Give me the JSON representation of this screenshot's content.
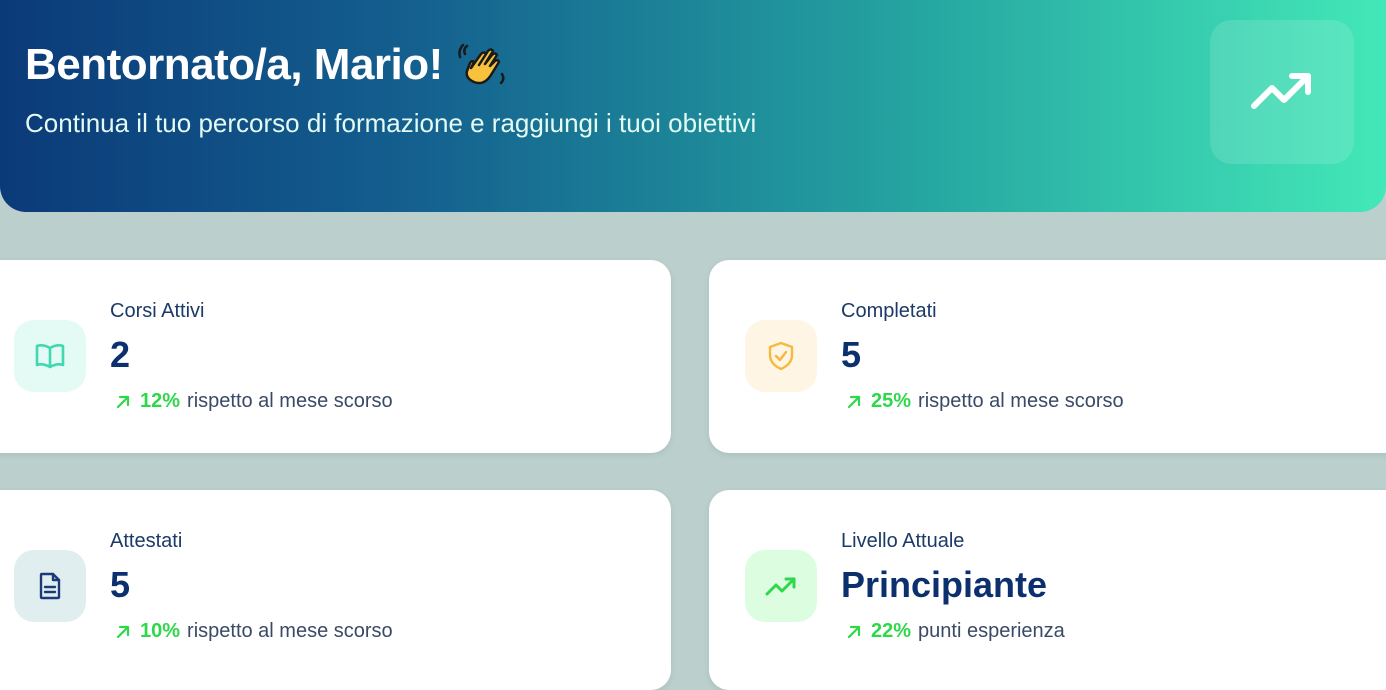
{
  "hero": {
    "title": "Bentornato/a, Mario!",
    "subtitle": "Continua il tuo percorso di formazione e raggiungi i tuoi obiettivi",
    "badge_icon": "trending-up-icon"
  },
  "colors": {
    "gradient_start": "#0b3a78",
    "gradient_end": "#43e8b8",
    "positive": "#2fd84a",
    "value_text": "#0c2f6e"
  },
  "cards": [
    {
      "label": "Corsi Attivi",
      "value": "2",
      "pct": "12%",
      "trend_text": "rispetto al mese scorso",
      "icon": "book-icon",
      "icon_color": "#3fd8b0",
      "icon_bg": "#e3fbf4"
    },
    {
      "label": "Completati",
      "value": "5",
      "pct": "25%",
      "trend_text": "rispetto al mese scorso",
      "icon": "shield-check-icon",
      "icon_color": "#f5b93b",
      "icon_bg": "#fff5e5"
    },
    {
      "label": "Attestati",
      "value": "5",
      "pct": "10%",
      "trend_text": "rispetto al mese scorso",
      "icon": "document-icon",
      "icon_color": "#1c3a78",
      "icon_bg": "#e1eef0"
    },
    {
      "label": "Livello Attuale",
      "value": "Principiante",
      "pct": "22%",
      "trend_text": "punti esperienza",
      "icon": "trending-up-icon",
      "icon_color": "#2fd84a",
      "icon_bg": "#dcfddf"
    }
  ]
}
